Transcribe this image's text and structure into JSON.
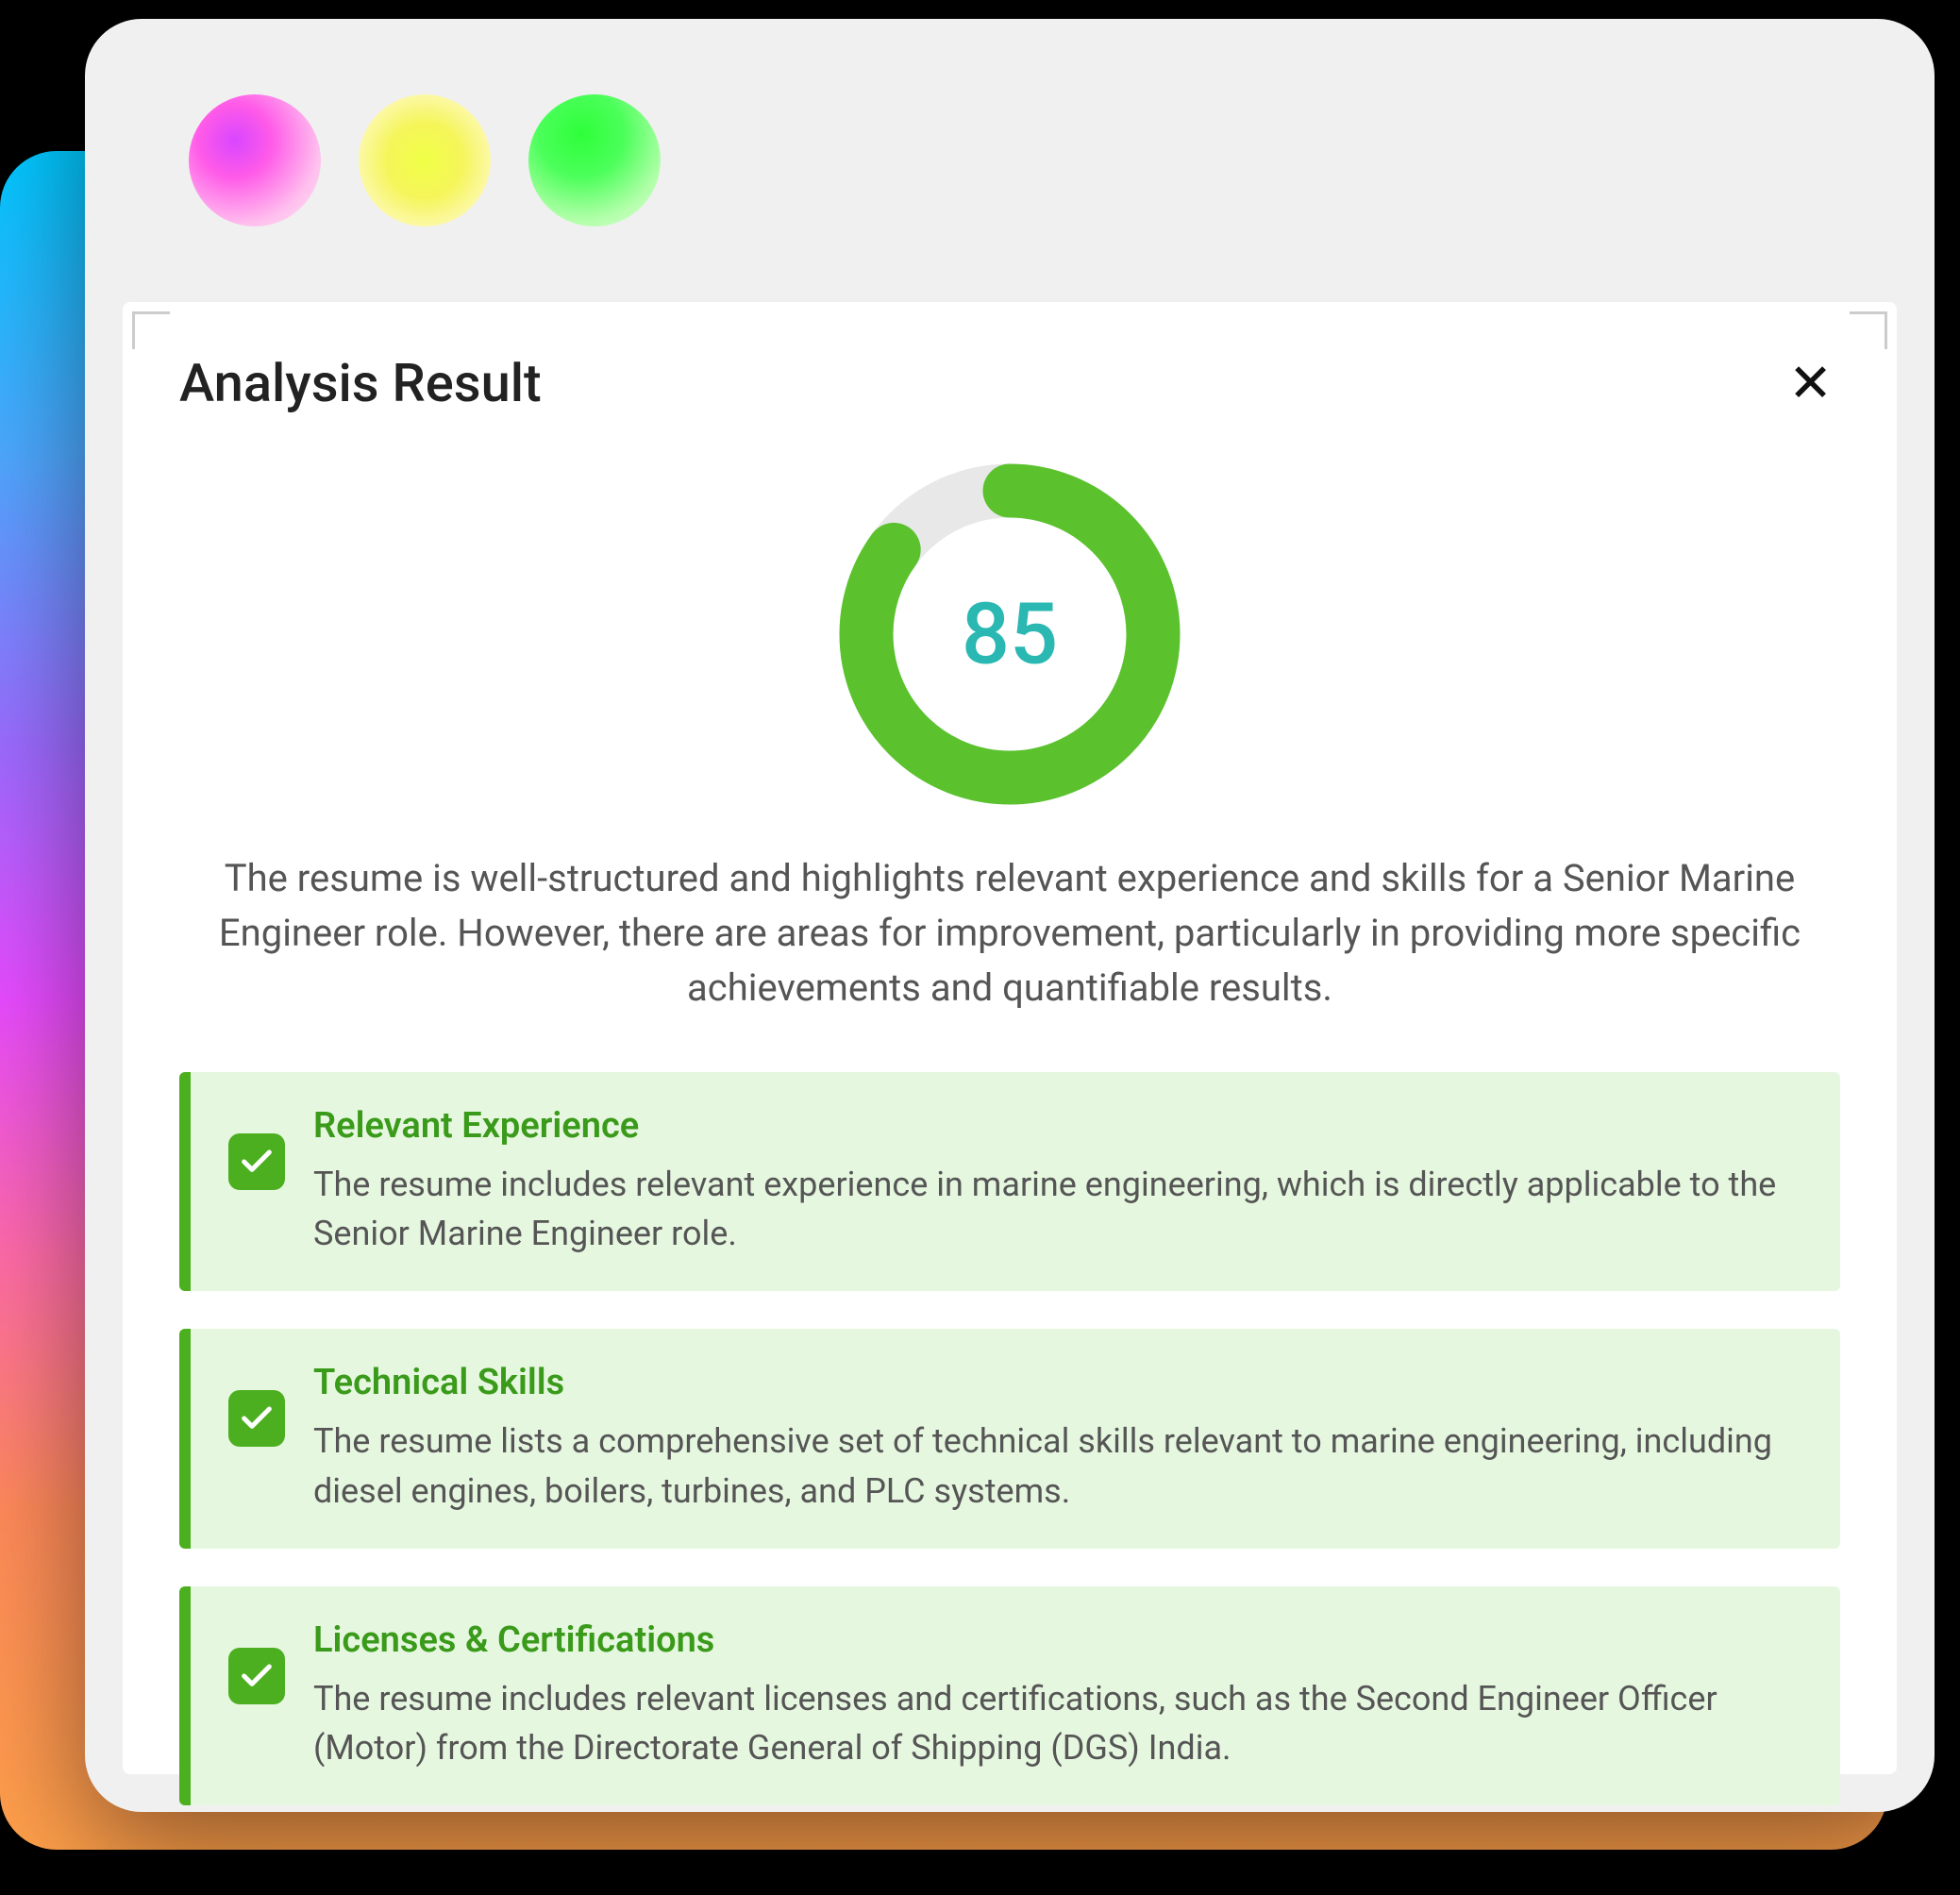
{
  "modal": {
    "title": "Analysis Result",
    "score": 85,
    "score_color": "#5BC22E",
    "summary": "The resume is well-structured and highlights relevant experience and skills for a Senior Marine Engineer role. However, there are areas for improvement, particularly in providing more specific achievements and quantifiable results."
  },
  "cards": [
    {
      "title": "Relevant Experience",
      "text": "The resume includes relevant experience in marine engineering, which is directly applicable to the Senior Marine Engineer role."
    },
    {
      "title": "Technical Skills",
      "text": "The resume lists a comprehensive set of technical skills relevant to marine engineering, including diesel engines, boilers, turbines, and PLC systems."
    },
    {
      "title": "Licenses & Certifications",
      "text": "The resume includes relevant licenses and certifications, such as the Second Engineer Officer (Motor) from the Directorate General of Shipping (DGS) India."
    }
  ]
}
